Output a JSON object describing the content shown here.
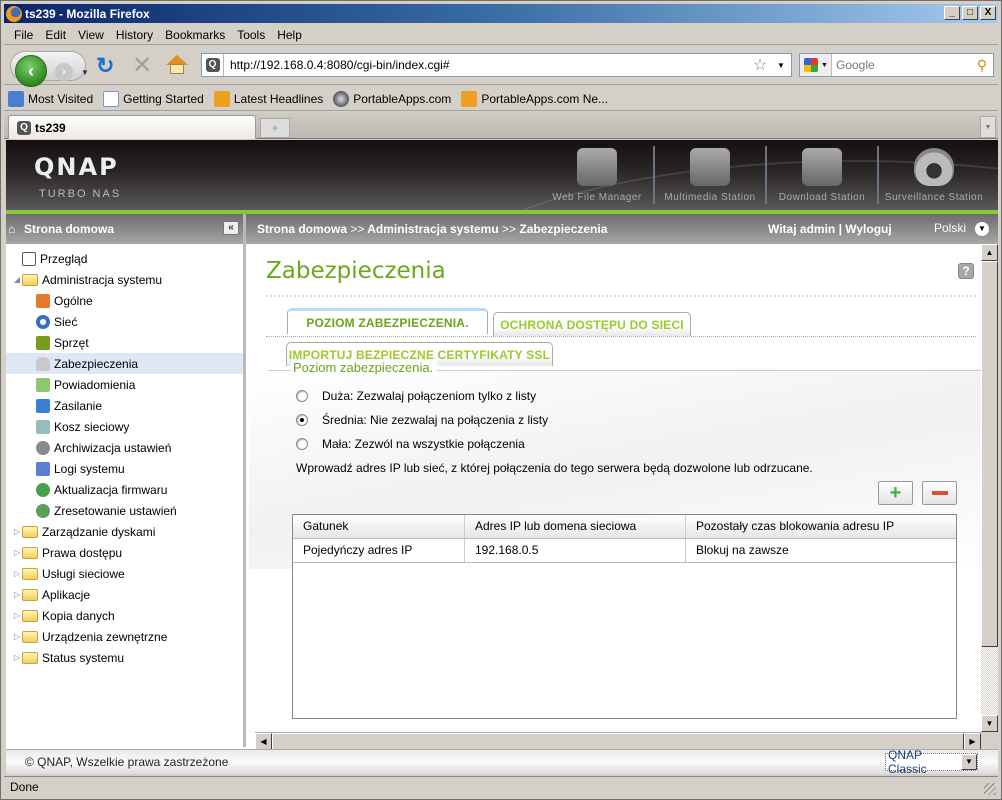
{
  "browser": {
    "window_title": "ts239 - Mozilla Firefox",
    "window_buttons": [
      "_",
      "□",
      "X"
    ],
    "menu": [
      {
        "label": "File",
        "accel": "F"
      },
      {
        "label": "Edit",
        "accel": "E"
      },
      {
        "label": "View",
        "accel": "V"
      },
      {
        "label": "History",
        "accel": "s"
      },
      {
        "label": "Bookmarks",
        "accel": "B"
      },
      {
        "label": "Tools",
        "accel": "T"
      },
      {
        "label": "Help",
        "accel": "H"
      }
    ],
    "url": "http://192.168.0.4:8080/cgi-bin/index.cgi#",
    "search_placeholder": "Google",
    "bookmarks": [
      {
        "label": "Most Visited",
        "icon": "most-visited-icon"
      },
      {
        "label": "Getting Started",
        "icon": "page-icon"
      },
      {
        "label": "Latest Headlines",
        "icon": "rss-icon"
      },
      {
        "label": "PortableApps.com",
        "icon": "portableapps-icon"
      },
      {
        "label": "PortableApps.com Ne...",
        "icon": "rss-icon"
      }
    ],
    "tab_title": "ts239",
    "status": "Done"
  },
  "header": {
    "logo": "QNAP",
    "subtitle": "Turbo NAS",
    "apps": [
      {
        "label": "Web File Manager",
        "icon": "web-file-manager-icon"
      },
      {
        "label": "Multimedia Station",
        "icon": "multimedia-station-icon"
      },
      {
        "label": "Download Station",
        "icon": "download-station-icon"
      },
      {
        "label": "Surveillance Station",
        "icon": "surveillance-camera-icon"
      }
    ]
  },
  "crumbbar": {
    "sidebar_title": "Strona domowa",
    "collapse": "«",
    "breadcrumb": [
      "Strona domowa",
      "Administracja systemu",
      "Zabezpieczenia"
    ],
    "separator": ">>",
    "welcome": "Witaj admin",
    "logout": "Wyloguj",
    "language": "Polski"
  },
  "sidebar": {
    "items": [
      {
        "label": "Przegląd",
        "level": 0,
        "type": "leaf"
      },
      {
        "label": "Administracja systemu",
        "level": 0,
        "type": "folder",
        "expanded": true
      },
      {
        "label": "Ogólne",
        "level": 1,
        "type": "leaf"
      },
      {
        "label": "Sieć",
        "level": 1,
        "type": "leaf"
      },
      {
        "label": "Sprzęt",
        "level": 1,
        "type": "leaf"
      },
      {
        "label": "Zabezpieczenia",
        "level": 1,
        "type": "leaf",
        "selected": true
      },
      {
        "label": "Powiadomienia",
        "level": 1,
        "type": "leaf"
      },
      {
        "label": "Zasilanie",
        "level": 1,
        "type": "leaf"
      },
      {
        "label": "Kosz sieciowy",
        "level": 1,
        "type": "leaf"
      },
      {
        "label": "Archiwizacja ustawień",
        "level": 1,
        "type": "leaf"
      },
      {
        "label": "Logi systemu",
        "level": 1,
        "type": "leaf"
      },
      {
        "label": "Aktualizacja firmwaru",
        "level": 1,
        "type": "leaf"
      },
      {
        "label": "Zresetowanie ustawień",
        "level": 1,
        "type": "leaf"
      },
      {
        "label": "Zarządzanie dyskami",
        "level": 0,
        "type": "folder",
        "expanded": false
      },
      {
        "label": "Prawa dostępu",
        "level": 0,
        "type": "folder",
        "expanded": false
      },
      {
        "label": "Usługi sieciowe",
        "level": 0,
        "type": "folder",
        "expanded": false
      },
      {
        "label": "Aplikacje",
        "level": 0,
        "type": "folder",
        "expanded": false
      },
      {
        "label": "Kopia danych",
        "level": 0,
        "type": "folder",
        "expanded": false
      },
      {
        "label": "Urządzenia zewnętrzne",
        "level": 0,
        "type": "folder",
        "expanded": false
      },
      {
        "label": "Status systemu",
        "level": 0,
        "type": "folder",
        "expanded": false
      }
    ]
  },
  "main": {
    "title": "Zabezpieczenia",
    "help": "?",
    "tabs": [
      {
        "label": "POZIOM ZABEZPIECZENIA.",
        "active": true
      },
      {
        "label": "OCHRONA DOSTĘPU DO SIECI",
        "active": false
      },
      {
        "label": "IMPORTUJ BEZPIECZNE CERTYFIKATY SSL",
        "active": false
      }
    ],
    "section_title": "Poziom zabezpieczenia.",
    "options": [
      {
        "label": "Duża: Zezwalaj połączeniom tylko z listy",
        "checked": false
      },
      {
        "label": "Średnia: Nie zezwalaj na połączenia z listy",
        "checked": true
      },
      {
        "label": "Mała: Zezwól na wszystkie połączenia",
        "checked": false
      }
    ],
    "hint": "Wprowadź adres IP lub sieć, z której połączenia do tego serwera będą dozwolone lub odrzucane.",
    "add_button": "+",
    "table": {
      "columns": [
        "Gatunek",
        "Adres IP lub domena sieciowa",
        "Pozostały czas blokowania adresu IP"
      ],
      "rows": [
        [
          "Pojedyńczy adres IP",
          "192.168.0.5",
          "Blokuj na zawsze"
        ]
      ]
    }
  },
  "footer": {
    "copyright": "© QNAP, Wszelkie prawa zastrzeżone",
    "theme": "QNAP Classic"
  }
}
